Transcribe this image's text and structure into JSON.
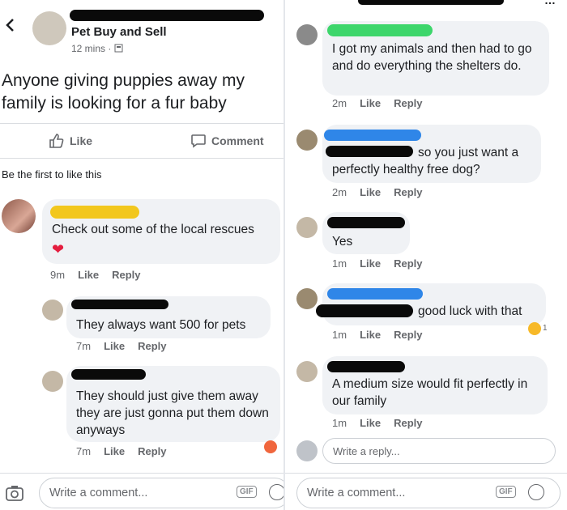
{
  "post": {
    "group_name": "Pet Buy and Sell",
    "time": "12 mins ·",
    "text": "Anyone giving puppies away my family is looking for a fur baby",
    "like_label": "Like",
    "comment_label": "Comment",
    "first_like": "Be the first to like this"
  },
  "left_comments": [
    {
      "text": "Check out some of the local rescues",
      "reaction": "❤",
      "time": "9m",
      "like": "Like",
      "reply": "Reply"
    },
    {
      "text": "They always want 500 for pets",
      "time": "7m",
      "like": "Like",
      "reply": "Reply"
    },
    {
      "text": "They should just give them away they are just gonna put them down anyways",
      "time": "7m",
      "like": "Like",
      "reply": "Reply"
    }
  ],
  "right_comments": [
    {
      "text": "I got my animals and then had to go and do everything the shelters do.",
      "time": "2m",
      "like": "Like",
      "reply": "Reply"
    },
    {
      "text": "so you just want a perfectly healthy free dog?",
      "time": "2m",
      "like": "Like",
      "reply": "Reply"
    },
    {
      "text": "Yes",
      "time": "1m",
      "like": "Like",
      "reply": "Reply"
    },
    {
      "text": "good luck with that",
      "time": "1m",
      "like": "Like",
      "reply": "Reply",
      "reaction_count": "1"
    },
    {
      "text": "A medium size would fit perfectly in our family",
      "time": "1m",
      "like": "Like",
      "reply": "Reply"
    }
  ],
  "reply_placeholder": "Write a reply...",
  "comment_placeholder": "Write a comment...",
  "gif_label": "GIF",
  "colors": {
    "bubble": "#f0f2f5",
    "meta": "#65676b",
    "border": "#ccd0d5"
  }
}
